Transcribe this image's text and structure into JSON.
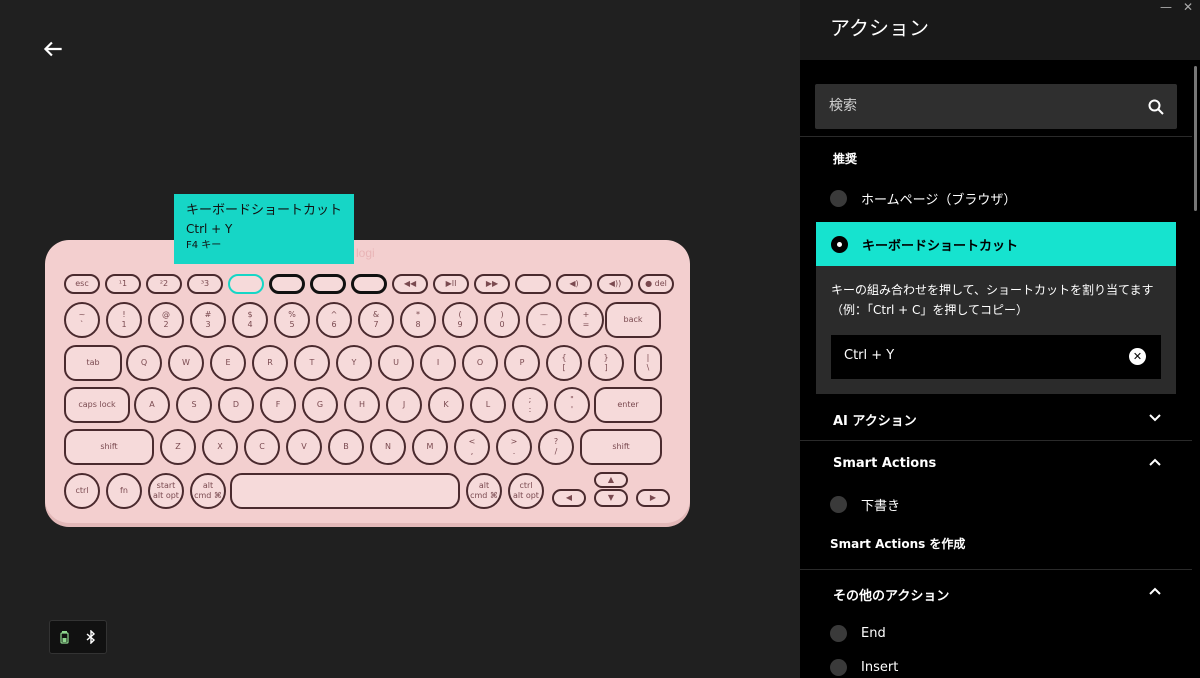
{
  "back": {
    "icon": "arrow-left-icon"
  },
  "tooltip": {
    "line1": "キーボードショートカット",
    "line2": "Ctrl + Y",
    "line3": "F4 キー"
  },
  "keyboard": {
    "brand": "logi",
    "color": "#f3cfcf",
    "row0": [
      "esc",
      "¹1",
      "²2",
      "³3",
      "",
      "",
      "",
      "",
      "◀◀",
      "▶II",
      "▶▶",
      "",
      "◀)",
      "◀))",
      "● del"
    ],
    "row1": [
      [
        "~",
        "`"
      ],
      [
        "!",
        "1"
      ],
      [
        "@",
        "2"
      ],
      [
        "#",
        "3"
      ],
      [
        "$",
        "4"
      ],
      [
        "%",
        "5"
      ],
      [
        "^",
        "6"
      ],
      [
        "&",
        "7"
      ],
      [
        "*",
        "8"
      ],
      [
        "(",
        "9"
      ],
      [
        ")",
        "0"
      ],
      [
        "—",
        "–"
      ],
      [
        "+",
        "="
      ],
      [
        "back",
        ""
      ]
    ],
    "row2": [
      "tab",
      "Q",
      "W",
      "E",
      "R",
      "T",
      "Y",
      "U",
      "I",
      "O",
      "P",
      "{ [",
      "} ]",
      "| \\"
    ],
    "row3": [
      "caps lock",
      "A",
      "S",
      "D",
      "F",
      "G",
      "H",
      "J",
      "K",
      "L",
      "; :",
      "\" '",
      "enter"
    ],
    "row4": [
      "shift",
      "Z",
      "X",
      "C",
      "V",
      "B",
      "N",
      "M",
      "< ,",
      "> .",
      "? /",
      "shift"
    ],
    "row5": [
      "ctrl",
      "fn",
      "start",
      "alt opt",
      "alt",
      "cmd ⌘",
      "alt",
      "cmd ⌘",
      "ctrl",
      "alt opt",
      "◀",
      "▲",
      "▼",
      "▶"
    ]
  },
  "status": {
    "battery_icon": "battery-icon",
    "bluetooth_icon": "bluetooth-icon"
  },
  "panel": {
    "title": "アクション",
    "minimize": "—",
    "close": "✕",
    "search_placeholder": "検索",
    "recommended_label": "推奨",
    "option_homepage": "ホームページ（ブラウザ）",
    "option_shortcut": "キーボードショートカット",
    "shortcut_description": "キーの組み合わせを押して、ショートカットを割り当てます（例：「Ctrl + C」を押してコピー）",
    "shortcut_value": "Ctrl + Y",
    "group_ai": "AI アクション",
    "group_smart": "Smart Actions",
    "option_draft": "下書き",
    "create_smart": "Smart Actions を作成",
    "group_other": "その他のアクション",
    "option_end": "End",
    "option_insert": "Insert"
  },
  "accent_color": "#16e3cf"
}
